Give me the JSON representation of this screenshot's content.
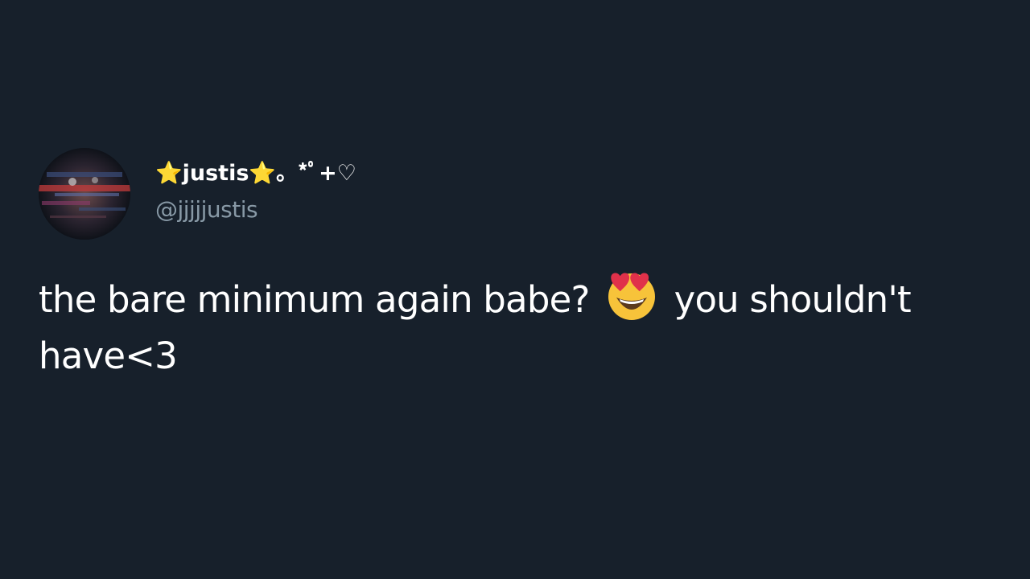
{
  "tweet": {
    "display_name": "⭐justis⭐。*ﾟ+♡",
    "handle": "@jjjjjustis",
    "text_before_emoji": "the bare minimum again babe?",
    "emoji": "smiling-face-with-heart-eyes-icon",
    "text_after_emoji": "you shouldn't have<3"
  },
  "colors": {
    "background": "#17202b",
    "text": "#ffffff",
    "handle": "#8899a6",
    "emoji_face": "#f7c33a",
    "emoji_hearts": "#e0314a"
  }
}
